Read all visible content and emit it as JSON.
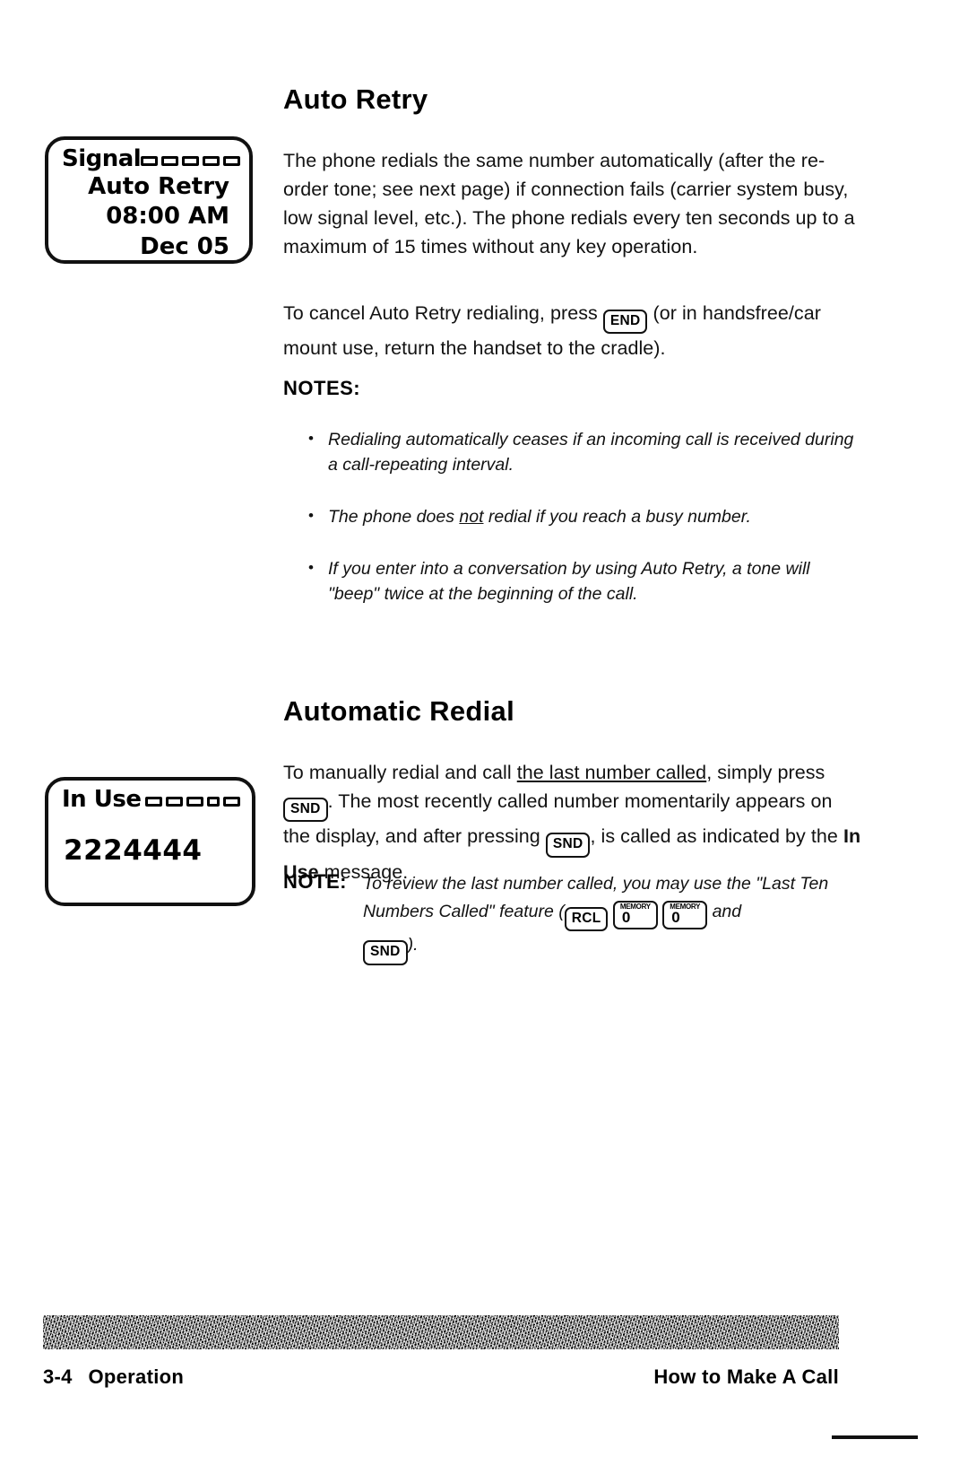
{
  "document": {
    "type": "cellular-phone-user-manual-page"
  },
  "sections": [
    {
      "heading": "Auto Retry",
      "paragraphs": [
        "The phone redials the same number automatically (after the re-order tone; see next page) if connection fails (carrier system busy, low signal level, etc.).  The phone redials every ten seconds up to a maximum of 15 times without any key operation.",
        "To cancel Auto Retry redialing, press"
      ]
    },
    {
      "heading": "Automatic Redial"
    }
  ],
  "auto_retry": {
    "heading": "Auto Retry",
    "intro_paragraph": "The phone redials the same number automatically (after the re-order tone; see next page) if connection fails (carrier system busy, low signal level, etc.).  The phone redials every ten seconds up to a maximum of 15 times without any key operation.",
    "cancel_text_before_key": "To cancel Auto Retry redialing, press",
    "cancel_key_label": "END",
    "cancel_text_after_key": "(or in handsfree/car mount use, return the handset to the cradle).",
    "notes_label": "NOTES:",
    "notes": [
      "Redialing automatically ceases if an incoming call is received during a call-repeating interval.",
      {
        "before": "The phone does",
        "underlined": "not",
        "after": "redial if you reach a busy number."
      },
      "If you enter into a conversation by using Auto Retry, a tone will \"beep\" twice at the beginning of the call."
    ]
  },
  "automatic_redial": {
    "heading": "Automatic Redial",
    "para_part1": "To manually redial and call",
    "para_underlined": "the last number called",
    "para_part2": ", simply press",
    "snd_key_label": "SND",
    "para_part3": ".  The most recently called number momentarily appears on the display, and after pressing",
    "para_part4": ", is called as indicated by the",
    "inline_bold": "In Use",
    "para_part5": "message.",
    "note_tag": "NOTE:",
    "note_part1": "To review the last number called, you may use the \"Last Ten Numbers Called\" feature (",
    "note_rcl_key": "RCL",
    "note_memory_label": "MEMORY",
    "note_memory_digit": "0",
    "note_part2": "and",
    "note_snd_key": "SND",
    "note_part3": ")."
  },
  "lcd_auto_retry": {
    "status": "Signal",
    "signal_bars_total": 5,
    "signal_bars_filled": 5,
    "lines": [
      "Auto Retry",
      "08:00 AM",
      "Dec 05"
    ]
  },
  "lcd_in_use": {
    "status": "In Use",
    "signal_bars_total": 5,
    "signal_bars_filled": 5,
    "number": "2224444"
  },
  "footer": {
    "page_number": "3-4",
    "left_label": "Operation",
    "right_label": "How to Make A Call"
  },
  "colors": {
    "ink": "#000000",
    "paper": "#ffffff"
  }
}
